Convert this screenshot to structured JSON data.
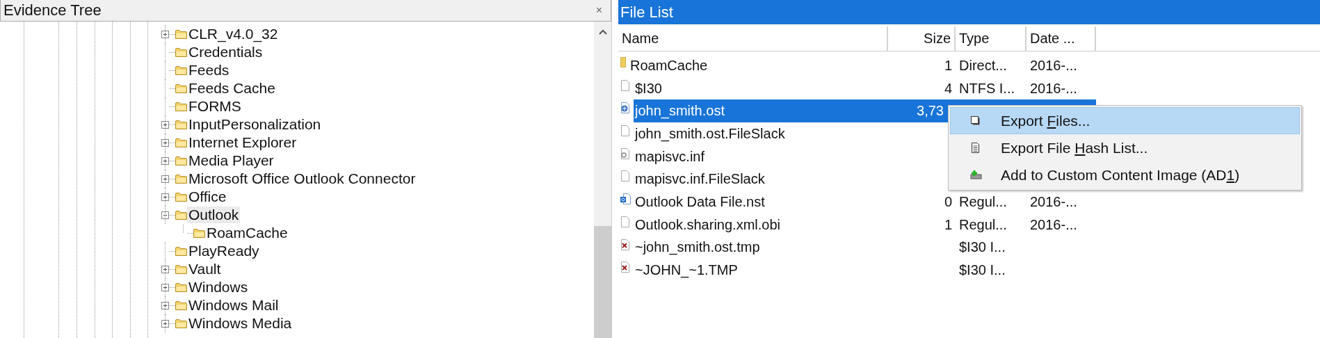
{
  "evidence_tree": {
    "title": "Evidence Tree",
    "close_glyph": "×",
    "items": [
      {
        "label": "CLR_v4.0_32",
        "has_children": true,
        "expanded": false,
        "selected": false
      },
      {
        "label": "Credentials",
        "has_children": false,
        "expanded": false,
        "selected": false
      },
      {
        "label": "Feeds",
        "has_children": false,
        "expanded": false,
        "selected": false
      },
      {
        "label": "Feeds Cache",
        "has_children": false,
        "expanded": false,
        "selected": false
      },
      {
        "label": "FORMS",
        "has_children": false,
        "expanded": false,
        "selected": false
      },
      {
        "label": "InputPersonalization",
        "has_children": true,
        "expanded": false,
        "selected": false
      },
      {
        "label": "Internet Explorer",
        "has_children": true,
        "expanded": false,
        "selected": false
      },
      {
        "label": "Media Player",
        "has_children": true,
        "expanded": false,
        "selected": false
      },
      {
        "label": "Microsoft Office Outlook Connector",
        "has_children": true,
        "expanded": false,
        "selected": false
      },
      {
        "label": "Office",
        "has_children": true,
        "expanded": false,
        "selected": false
      },
      {
        "label": "Outlook",
        "has_children": true,
        "expanded": true,
        "selected": true,
        "children": [
          {
            "label": "RoamCache",
            "has_children": false,
            "expanded": false,
            "selected": false
          }
        ]
      },
      {
        "label": "PlayReady",
        "has_children": false,
        "expanded": false,
        "selected": false
      },
      {
        "label": "Vault",
        "has_children": true,
        "expanded": false,
        "selected": false
      },
      {
        "label": "Windows",
        "has_children": true,
        "expanded": false,
        "selected": false
      },
      {
        "label": "Windows Mail",
        "has_children": true,
        "expanded": false,
        "selected": false
      },
      {
        "label": "Windows Media",
        "has_children": true,
        "expanded": false,
        "selected": false
      }
    ]
  },
  "file_list": {
    "title": "File List",
    "columns": [
      "Name",
      "Size",
      "Type",
      "Date ..."
    ],
    "rows": [
      {
        "kind": "folder",
        "name": "RoamCache",
        "size": "1",
        "type": "Direct...",
        "date": "2016-...",
        "selected": false
      },
      {
        "kind": "file",
        "name": "$I30",
        "size": "4",
        "type": "NTFS I...",
        "date": "2016-...",
        "selected": false
      },
      {
        "kind": "datafile",
        "name": "john_smith.ost",
        "size": "3,73",
        "selected": true
      },
      {
        "kind": "file",
        "name": "john_smith.ost.FileSlack",
        "selected": false
      },
      {
        "kind": "settings",
        "name": "mapisvc.inf",
        "selected": false
      },
      {
        "kind": "file",
        "name": "mapisvc.inf.FileSlack",
        "selected": false
      },
      {
        "kind": "outlook",
        "name": "Outlook Data File.nst",
        "size": "0",
        "type": "Regul...",
        "date": "2016-...",
        "selected": false
      },
      {
        "kind": "file",
        "name": "Outlook.sharing.xml.obi",
        "size": "1",
        "type": "Regul...",
        "date": "2016-...",
        "selected": false
      },
      {
        "kind": "deleted",
        "name": "~john_smith.ost.tmp",
        "type": "$I30 I...",
        "selected": false
      },
      {
        "kind": "deleted",
        "name": "~JOHN_~1.TMP",
        "type": "$I30 I...",
        "selected": false
      }
    ]
  },
  "context_menu": {
    "items": [
      {
        "kind": "export",
        "label_parts": [
          "Export ",
          "F",
          "iles..."
        ],
        "selected": true
      },
      {
        "kind": "hash",
        "label_parts": [
          "Export File ",
          "H",
          "ash List..."
        ],
        "selected": false
      },
      {
        "kind": "image",
        "label_parts": [
          "Add to Custom Content Image (AD",
          "1",
          ")"
        ],
        "selected": false
      }
    ]
  }
}
